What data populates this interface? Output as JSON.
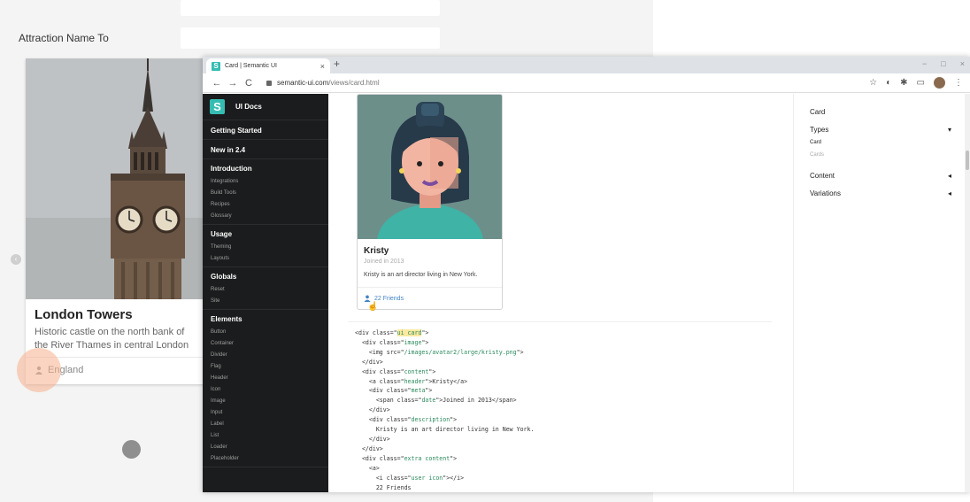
{
  "background_app": {
    "attraction_name_to_label": "Attraction Name To",
    "card": {
      "title": "London Towers",
      "description": "Historic castle on the north bank of the River Thames in central London",
      "location": "England"
    }
  },
  "browser": {
    "tab_title": "Card | Semantic UI",
    "favicon_letter": "S",
    "tab_close": "×",
    "new_tab": "+",
    "window_controls": [
      "−",
      "□",
      "×"
    ],
    "url_domain": "semantic-ui.com",
    "url_path": "/views/card.html",
    "nav": {
      "back": "←",
      "forward": "→",
      "reload": "C"
    },
    "toolbar_icons": [
      "☆",
      "◐",
      "✱",
      "▭",
      "⋮"
    ]
  },
  "sidebar": {
    "logo_letter": "S",
    "logo_text": "UI Docs",
    "top_items": [
      "Getting Started",
      "New in 2.4"
    ],
    "sections": [
      {
        "header": "Introduction",
        "items": [
          "Integrations",
          "Build Tools",
          "Recipes",
          "Glossary"
        ]
      },
      {
        "header": "Usage",
        "items": [
          "Theming",
          "Layouts"
        ]
      },
      {
        "header": "Globals",
        "items": [
          "Reset",
          "Site"
        ]
      },
      {
        "header": "Elements",
        "items": [
          "Button",
          "Container",
          "Divider",
          "Flag",
          "Header",
          "Icon",
          "Image",
          "Input",
          "Label",
          "List",
          "Loader",
          "Placeholder"
        ]
      }
    ]
  },
  "example_card": {
    "name": "Kristy",
    "meta": "Joined in 2013",
    "description": "Kristy is an art director living in New York.",
    "friends": "22 Friends"
  },
  "code_lines": [
    [
      [
        "t",
        "<div class=\""
      ],
      [
        "h",
        "ui card"
      ],
      [
        "t",
        "\">"
      ]
    ],
    [
      [
        "t",
        "  <div class=\""
      ],
      [
        "a",
        "image"
      ],
      [
        "t",
        "\">"
      ]
    ],
    [
      [
        "t",
        "    <img src=\""
      ],
      [
        "a",
        "/images/avatar2/large/kristy.png"
      ],
      [
        "t",
        "\">"
      ]
    ],
    [
      [
        "t",
        "  </div>"
      ]
    ],
    [
      [
        "t",
        "  <div class=\""
      ],
      [
        "a",
        "content"
      ],
      [
        "t",
        "\">"
      ]
    ],
    [
      [
        "t",
        "    <a class=\""
      ],
      [
        "a",
        "header"
      ],
      [
        "t",
        "\">Kristy</a>"
      ]
    ],
    [
      [
        "t",
        "    <div class=\""
      ],
      [
        "a",
        "meta"
      ],
      [
        "t",
        "\">"
      ]
    ],
    [
      [
        "t",
        "      <span class=\""
      ],
      [
        "a",
        "date"
      ],
      [
        "t",
        "\">Joined in 2013</span>"
      ]
    ],
    [
      [
        "t",
        "    </div>"
      ]
    ],
    [
      [
        "t",
        "    <div class=\""
      ],
      [
        "a",
        "description"
      ],
      [
        "t",
        "\">"
      ]
    ],
    [
      [
        "t",
        "      Kristy is an art director living in New York."
      ]
    ],
    [
      [
        "t",
        "    </div>"
      ]
    ],
    [
      [
        "t",
        "  </div>"
      ]
    ],
    [
      [
        "t",
        "  <div class=\""
      ],
      [
        "a",
        "extra content"
      ],
      [
        "t",
        "\">"
      ]
    ],
    [
      [
        "t",
        "    <a>"
      ]
    ],
    [
      [
        "t",
        "      <i class=\""
      ],
      [
        "a",
        "user icon"
      ],
      [
        "t",
        "\"></i>"
      ]
    ],
    [
      [
        "t",
        "      22 Friends"
      ]
    ]
  ],
  "toc": {
    "title": "Card",
    "types": "Types",
    "types_sub": [
      "Card",
      "Cards"
    ],
    "content": "Content",
    "variations": "Variations",
    "chevron_down": "▾",
    "chevron_left": "◂"
  },
  "colors": {
    "semantic_teal": "#35bdb2",
    "sidebar_bg": "#1b1c1d",
    "link_blue": "#4183c4",
    "ripple": "#f6b08c"
  }
}
